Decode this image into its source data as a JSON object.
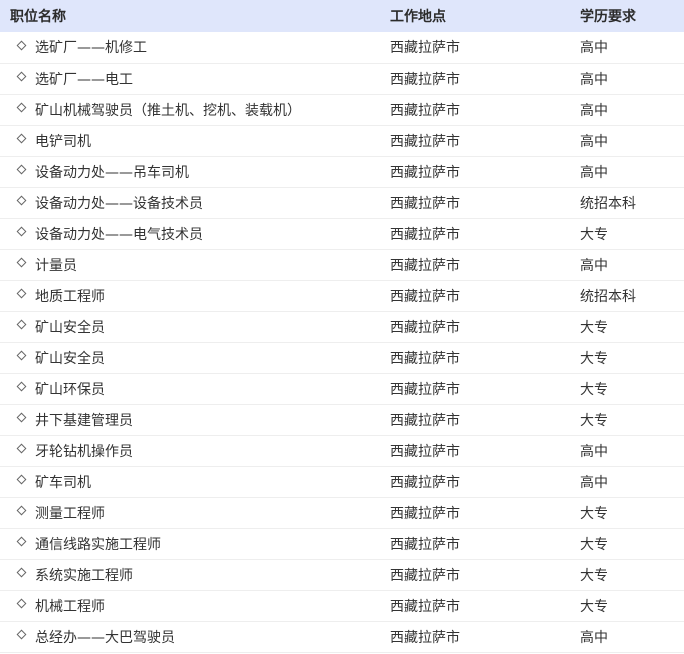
{
  "table": {
    "headers": {
      "title": "职位名称",
      "location": "工作地点",
      "education": "学历要求"
    },
    "rows": [
      {
        "title": "选矿厂——机修工",
        "location": "西藏拉萨市",
        "education": "高中"
      },
      {
        "title": "选矿厂——电工",
        "location": "西藏拉萨市",
        "education": "高中"
      },
      {
        "title": "矿山机械驾驶员（推土机、挖机、装载机）",
        "location": "西藏拉萨市",
        "education": "高中"
      },
      {
        "title": "电铲司机",
        "location": "西藏拉萨市",
        "education": "高中"
      },
      {
        "title": "设备动力处——吊车司机",
        "location": "西藏拉萨市",
        "education": "高中"
      },
      {
        "title": "设备动力处——设备技术员",
        "location": "西藏拉萨市",
        "education": "统招本科"
      },
      {
        "title": "设备动力处——电气技术员",
        "location": "西藏拉萨市",
        "education": "大专"
      },
      {
        "title": "计量员",
        "location": "西藏拉萨市",
        "education": "高中"
      },
      {
        "title": "地质工程师",
        "location": "西藏拉萨市",
        "education": "统招本科"
      },
      {
        "title": "矿山安全员",
        "location": "西藏拉萨市",
        "education": "大专"
      },
      {
        "title": "矿山安全员",
        "location": "西藏拉萨市",
        "education": "大专"
      },
      {
        "title": "矿山环保员",
        "location": "西藏拉萨市",
        "education": "大专"
      },
      {
        "title": "井下基建管理员",
        "location": "西藏拉萨市",
        "education": "大专"
      },
      {
        "title": "牙轮钻机操作员",
        "location": "西藏拉萨市",
        "education": "高中"
      },
      {
        "title": "矿车司机",
        "location": "西藏拉萨市",
        "education": "高中"
      },
      {
        "title": "测量工程师",
        "location": "西藏拉萨市",
        "education": "大专"
      },
      {
        "title": "通信线路实施工程师",
        "location": "西藏拉萨市",
        "education": "大专"
      },
      {
        "title": "系统实施工程师",
        "location": "西藏拉萨市",
        "education": "大专"
      },
      {
        "title": "机械工程师",
        "location": "西藏拉萨市",
        "education": "大专"
      },
      {
        "title": "总经办——大巴驾驶员",
        "location": "西藏拉萨市",
        "education": "高中"
      }
    ]
  },
  "icons": {
    "row_bullet": "diamond-icon"
  },
  "colors": {
    "header_background": "#dfe6fb",
    "text": "#333333",
    "row_divider": "#eeeeee"
  }
}
